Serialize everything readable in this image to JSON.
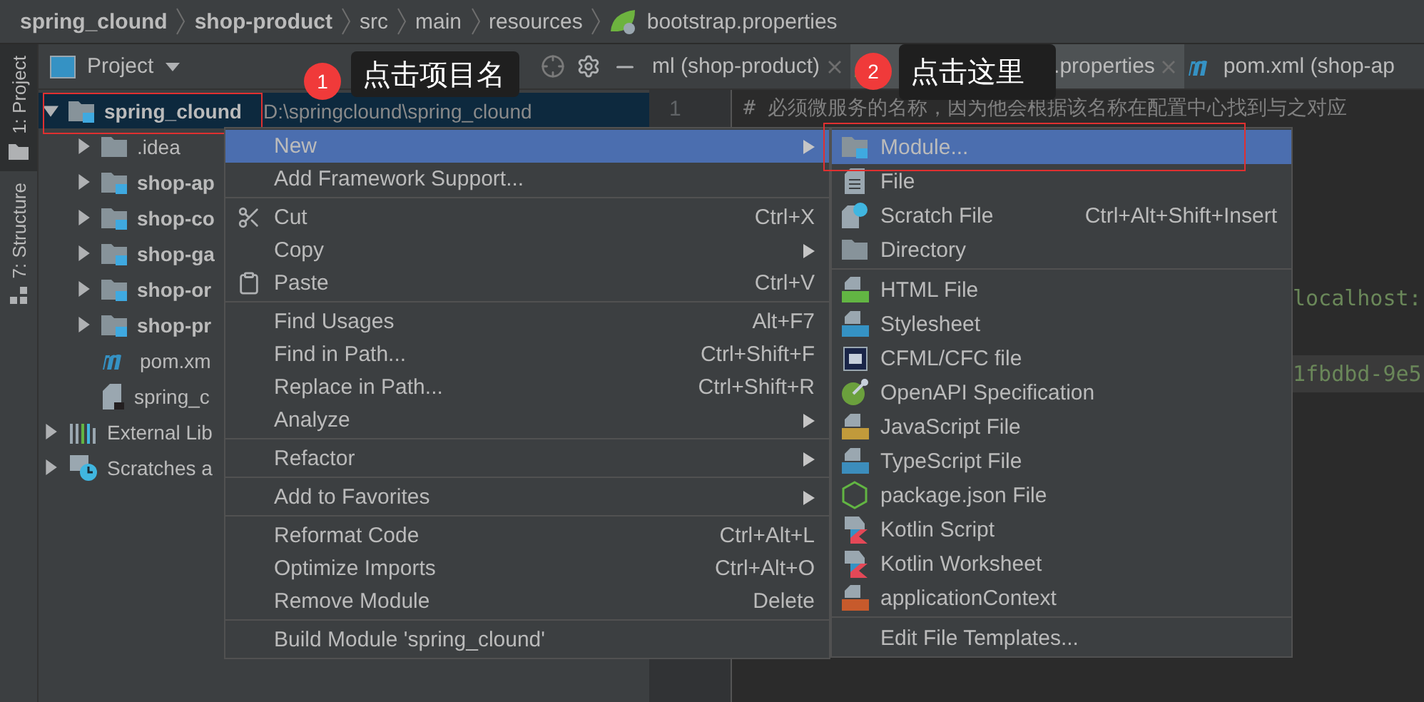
{
  "breadcrumbs": [
    {
      "label": "spring_clound",
      "bold": true
    },
    {
      "label": "shop-product",
      "bold": true
    },
    {
      "label": "src",
      "bold": false
    },
    {
      "label": "main",
      "bold": false
    },
    {
      "label": "resources",
      "bold": false
    },
    {
      "label": "bootstrap.properties",
      "bold": false
    }
  ],
  "tool_strip": [
    {
      "label": "1: Project",
      "selected": true
    },
    {
      "label": "7: Structure",
      "selected": false
    }
  ],
  "project_panel": {
    "title": "Project",
    "tree": [
      {
        "label": "spring_clound",
        "path": "D:\\springclound\\spring_clound",
        "kind": "module",
        "bold": true,
        "expanded": true,
        "selected": true,
        "children": [
          {
            "label": ".idea",
            "kind": "folder",
            "bold": false,
            "expanded": false,
            "selected": false
          },
          {
            "label": "shop-ap",
            "kind": "module",
            "bold": true,
            "expanded": false,
            "selected": false
          },
          {
            "label": "shop-co",
            "kind": "module",
            "bold": true,
            "expanded": false,
            "selected": false
          },
          {
            "label": "shop-ga",
            "kind": "module",
            "bold": true,
            "expanded": false,
            "selected": false
          },
          {
            "label": "shop-or",
            "kind": "module",
            "bold": true,
            "expanded": false,
            "selected": false
          },
          {
            "label": "shop-pr",
            "kind": "module",
            "bold": true,
            "expanded": false,
            "selected": false
          },
          {
            "label": "pom.xm",
            "kind": "maven",
            "bold": false,
            "selected": false
          },
          {
            "label": "spring_c",
            "kind": "file",
            "bold": false,
            "selected": false
          }
        ]
      },
      {
        "label": "External Lib",
        "kind": "library",
        "bold": false,
        "expanded": false,
        "selected": false
      },
      {
        "label": "Scratches a",
        "kind": "scratches",
        "bold": false,
        "expanded": false,
        "selected": false
      }
    ]
  },
  "editor": {
    "tabs": [
      {
        "label": "ml (shop-product)",
        "selected": false
      },
      {
        "label": ".properties",
        "selected": true
      },
      {
        "label": "pom.xml (shop-ap",
        "selected": false
      }
    ],
    "lines": [
      {
        "number": "1",
        "text": "#  必须微服务的名称，因为他会根据该名称在配置中心找到与之对应",
        "kind": "comment",
        "current": false
      },
      {
        "text": "localhost:",
        "kind": "string",
        "current": false
      },
      {
        "text": "1fbdbd-9e5",
        "kind": "string",
        "current": true
      }
    ]
  },
  "context_menu": [
    {
      "kind": "plain",
      "label": "New",
      "submenu": true,
      "selected": true
    },
    {
      "kind": "plain",
      "label": "Add Framework Support...",
      "submenu": false,
      "selected": false
    },
    {
      "kind": "separator"
    },
    {
      "kind": "cut",
      "label": "Cut",
      "shortcut": "Ctrl+X",
      "submenu": false,
      "selected": false
    },
    {
      "kind": "plain",
      "label": "Copy",
      "submenu": true,
      "selected": false
    },
    {
      "kind": "paste",
      "label": "Paste",
      "shortcut": "Ctrl+V",
      "submenu": false,
      "selected": false
    },
    {
      "kind": "separator"
    },
    {
      "kind": "plain",
      "label": "Find Usages",
      "shortcut": "Alt+F7",
      "submenu": false,
      "selected": false
    },
    {
      "kind": "plain",
      "label": "Find in Path...",
      "shortcut": "Ctrl+Shift+F",
      "submenu": false,
      "selected": false
    },
    {
      "kind": "plain",
      "label": "Replace in Path...",
      "shortcut": "Ctrl+Shift+R",
      "submenu": false,
      "selected": false
    },
    {
      "kind": "plain",
      "label": "Analyze",
      "submenu": true,
      "selected": false
    },
    {
      "kind": "separator"
    },
    {
      "kind": "plain",
      "label": "Refactor",
      "submenu": true,
      "selected": false
    },
    {
      "kind": "separator"
    },
    {
      "kind": "plain",
      "label": "Add to Favorites",
      "submenu": true,
      "selected": false
    },
    {
      "kind": "separator"
    },
    {
      "kind": "plain",
      "label": "Reformat Code",
      "shortcut": "Ctrl+Alt+L",
      "submenu": false,
      "selected": false
    },
    {
      "kind": "plain",
      "label": "Optimize Imports",
      "shortcut": "Ctrl+Alt+O",
      "submenu": false,
      "selected": false
    },
    {
      "kind": "plain",
      "label": "Remove Module",
      "shortcut": "Delete",
      "submenu": false,
      "selected": false
    },
    {
      "kind": "separator"
    },
    {
      "kind": "plain",
      "label": "Build Module 'spring_clound'",
      "submenu": false,
      "selected": false
    }
  ],
  "new_submenu": [
    {
      "kind": "module",
      "label": "Module...",
      "selected": true
    },
    {
      "kind": "file",
      "label": "File",
      "selected": false
    },
    {
      "kind": "scratch",
      "label": "Scratch File",
      "shortcut": "Ctrl+Alt+Shift+Insert",
      "selected": false
    },
    {
      "kind": "folder",
      "label": "Directory",
      "selected": false
    },
    {
      "kind": "separator"
    },
    {
      "kind": "html",
      "label": "HTML File",
      "selected": false
    },
    {
      "kind": "css",
      "label": "Stylesheet",
      "selected": false
    },
    {
      "kind": "cfml",
      "label": "CFML/CFC file",
      "selected": false
    },
    {
      "kind": "openapi",
      "label": "OpenAPI Specification",
      "selected": false
    },
    {
      "kind": "js",
      "label": "JavaScript File",
      "selected": false
    },
    {
      "kind": "ts",
      "label": "TypeScript File",
      "selected": false
    },
    {
      "kind": "json",
      "label": "package.json File",
      "selected": false
    },
    {
      "kind": "kotlin",
      "label": "Kotlin Script",
      "selected": false
    },
    {
      "kind": "kotlin",
      "label": "Kotlin Worksheet",
      "selected": false
    },
    {
      "kind": "xml",
      "label": "applicationContext",
      "selected": false
    },
    {
      "kind": "separator"
    },
    {
      "kind": "plain",
      "label": "Edit File Templates...",
      "selected": false
    }
  ],
  "annotations": [
    {
      "number": "1",
      "text": "点击项目名"
    },
    {
      "number": "2",
      "text": "点击这里"
    }
  ]
}
